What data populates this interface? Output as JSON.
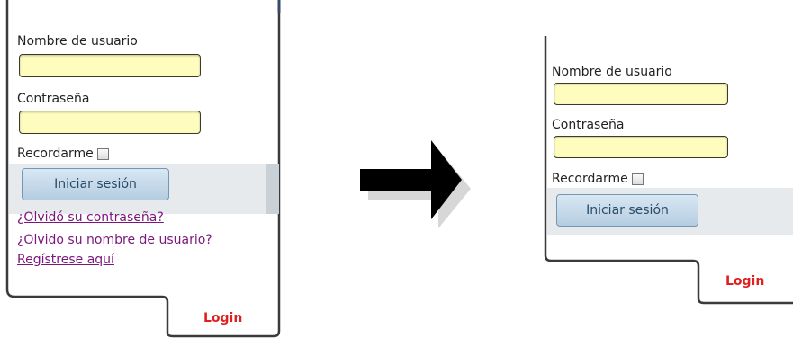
{
  "before": {
    "username_label": "Nombre de usuario",
    "password_label": "Contraseña",
    "remember_label": "Recordarme",
    "login_button": "Iniciar sesión",
    "links": [
      "¿Olvidó su contraseña?",
      "¿Olvido su nombre de usuario?",
      "Regístrese aquí"
    ],
    "tab_label": "Login"
  },
  "after": {
    "username_label": "Nombre de usuario",
    "password_label": "Contraseña",
    "remember_label": "Recordarme",
    "login_button": "Iniciar sesión",
    "tab_label": "Login"
  },
  "colors": {
    "input_bg": "#fffdbe",
    "button_bg": "#c6dbeb",
    "link": "#7b167b",
    "tab_label": "#e02020",
    "arrow": "#000000"
  },
  "icons": {
    "arrow": "right-arrow-icon"
  }
}
